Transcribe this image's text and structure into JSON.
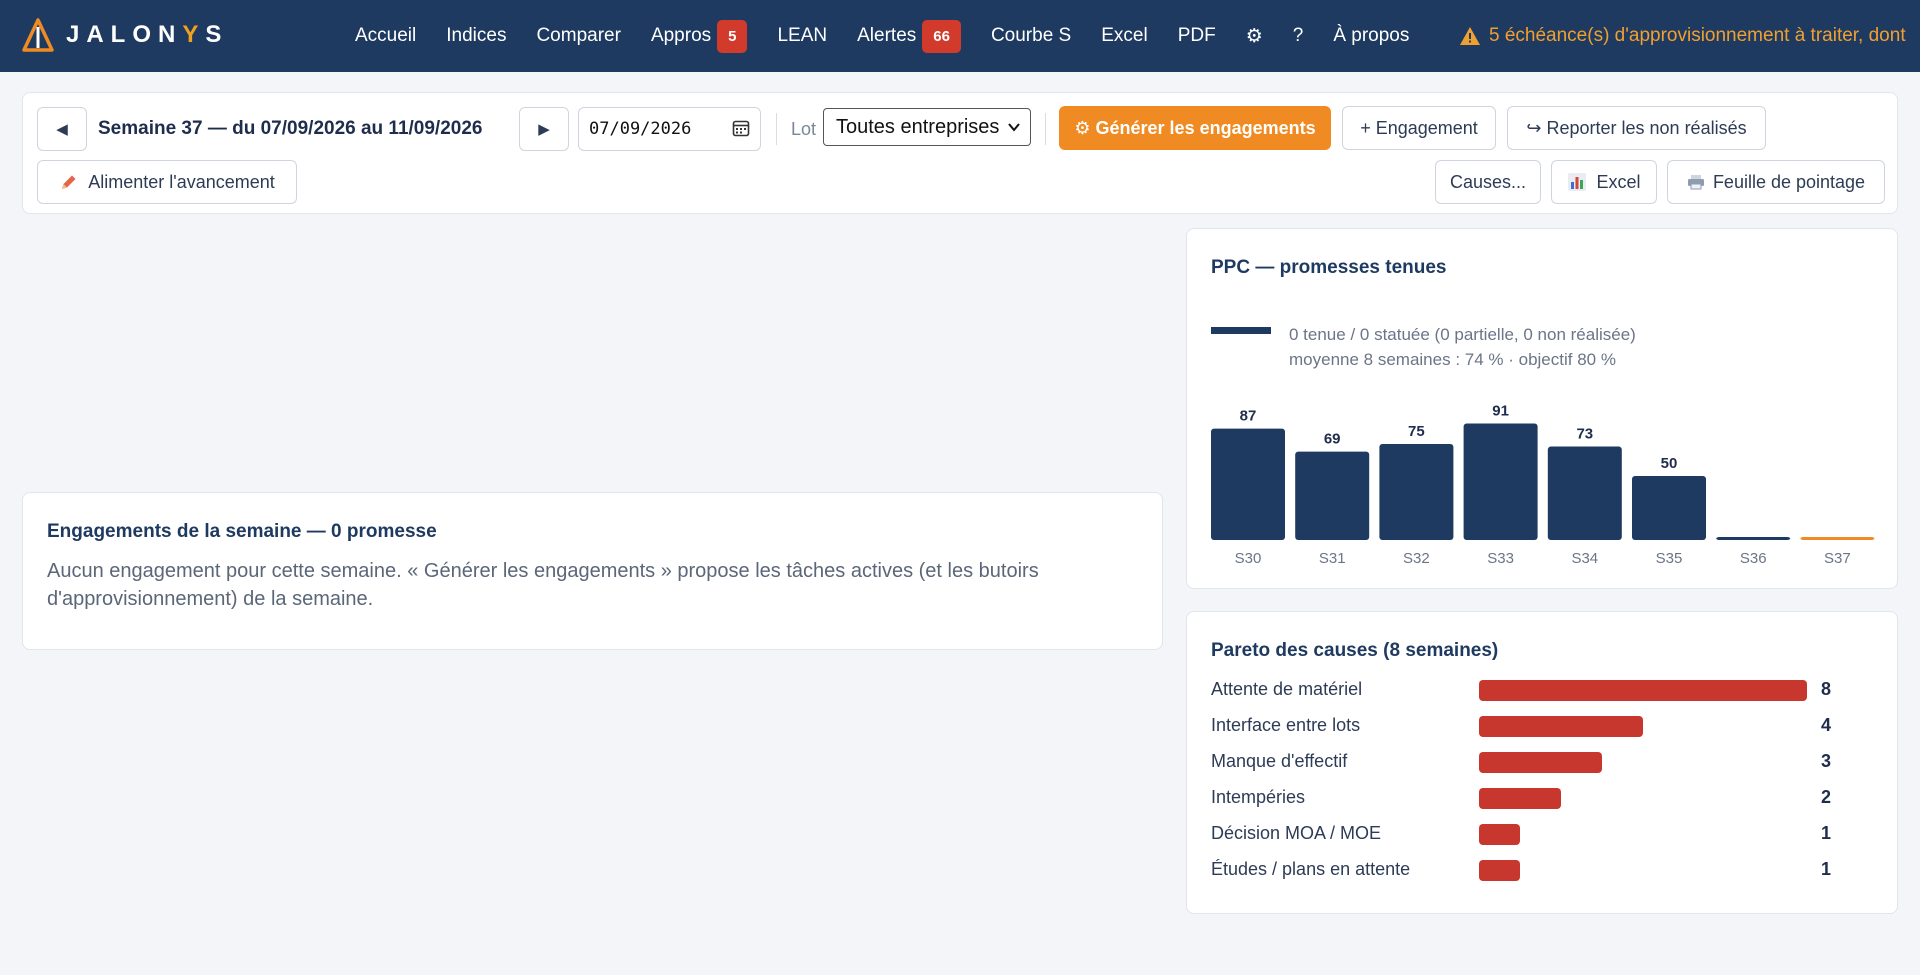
{
  "app": {
    "brand": "JALONYS",
    "brand_main": "JALON",
    "brand_accent": "Y",
    "brand_tail": "S"
  },
  "nav": {
    "items": [
      {
        "label": "Accueil"
      },
      {
        "label": "Indices"
      },
      {
        "label": "Comparer"
      },
      {
        "label": "Appros",
        "badge": "5"
      },
      {
        "label": "LEAN"
      },
      {
        "label": "Alertes",
        "badge": "66"
      },
      {
        "label": "Courbe S"
      },
      {
        "label": "Excel"
      },
      {
        "label": "PDF"
      },
      {
        "label": "⚙"
      },
      {
        "label": "?"
      },
      {
        "label": "À propos"
      }
    ],
    "alert_icon": "warning-icon",
    "alert_text": "5 échéance(s) d'approvisionnement à traiter, dont"
  },
  "toolbar": {
    "prev_icon": "◀",
    "next_icon": "▶",
    "week_label": "Semaine 37 — du 07/09/2026 au 11/09/2026",
    "date_value": "07/09/2026",
    "lot_label": "Lot",
    "lot_selected": "Toutes entreprises",
    "generate_label": "⚙ Générer les engagements",
    "add_label": "+ Engagement",
    "report_label": "↪ Reporter les non réalisés",
    "feed_label": "Alimenter l'avancement",
    "causes_label": "Causes...",
    "excel_label": "Excel",
    "sheet_label": "Feuille de pointage"
  },
  "engagements": {
    "title": "Engagements de la semaine — 0 promesse",
    "empty_text": "Aucun engagement pour cette semaine. « Générer les engagements » propose les tâches actives (et les butoirs d'approvisionnement) de la semaine."
  },
  "ppc": {
    "title": "PPC — promesses tenues",
    "info1": "0 tenue / 0 statuée (0 partielle, 0 non réalisée)",
    "info2": "moyenne 8 semaines : 74 % · objectif 80 %"
  },
  "chart_data": [
    {
      "type": "bar",
      "title": "PPC — promesses tenues",
      "categories": [
        "S30",
        "S31",
        "S32",
        "S33",
        "S34",
        "S35",
        "S36",
        "S37"
      ],
      "values": [
        87,
        69,
        75,
        91,
        73,
        50,
        0,
        0
      ],
      "data_labels": [
        "87",
        "69",
        "75",
        "91",
        "73",
        "50",
        "",
        ""
      ],
      "ylim": [
        0,
        100
      ],
      "colors": {
        "bar": "#1e3a60",
        "current": "#ef8b22"
      },
      "grid": false
    },
    {
      "type": "bar",
      "orientation": "horizontal",
      "title": "Pareto des causes (8 semaines)",
      "categories": [
        "Attente de matériel",
        "Interface entre lots",
        "Manque d'effectif",
        "Intempéries",
        "Décision MOA / MOE",
        "Études / plans en attente"
      ],
      "values": [
        8,
        4,
        3,
        2,
        1,
        1
      ],
      "colors": {
        "bar": "#c8372d"
      }
    }
  ],
  "pareto": {
    "title": "Pareto des causes (8 semaines)"
  },
  "colors": {
    "nav_bg": "#1e3a60",
    "accent": "#ef8b22",
    "danger": "#c8372d",
    "alert_text": "#f0a030"
  }
}
